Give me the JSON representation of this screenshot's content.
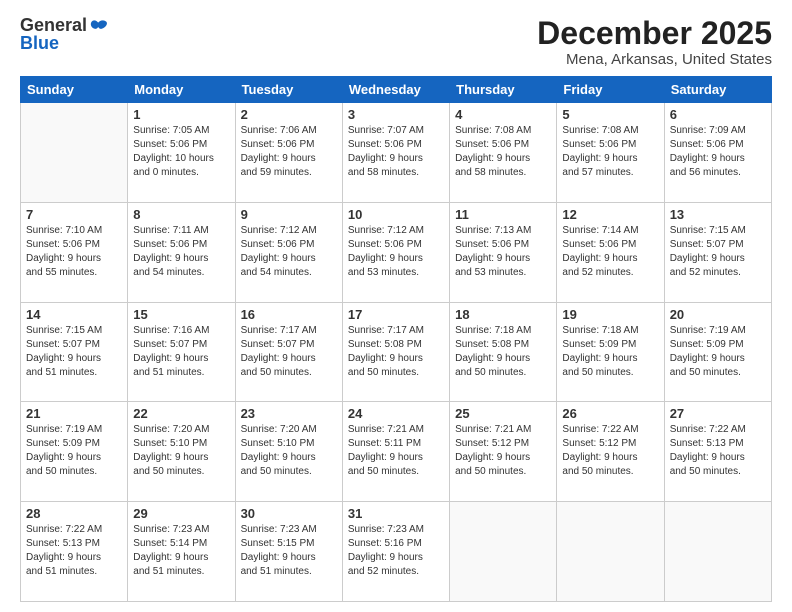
{
  "logo": {
    "general": "General",
    "blue": "Blue"
  },
  "header": {
    "title": "December 2025",
    "subtitle": "Mena, Arkansas, United States"
  },
  "weekdays": [
    "Sunday",
    "Monday",
    "Tuesday",
    "Wednesday",
    "Thursday",
    "Friday",
    "Saturday"
  ],
  "weeks": [
    [
      {
        "day": "",
        "info": ""
      },
      {
        "day": "1",
        "info": "Sunrise: 7:05 AM\nSunset: 5:06 PM\nDaylight: 10 hours\nand 0 minutes."
      },
      {
        "day": "2",
        "info": "Sunrise: 7:06 AM\nSunset: 5:06 PM\nDaylight: 9 hours\nand 59 minutes."
      },
      {
        "day": "3",
        "info": "Sunrise: 7:07 AM\nSunset: 5:06 PM\nDaylight: 9 hours\nand 58 minutes."
      },
      {
        "day": "4",
        "info": "Sunrise: 7:08 AM\nSunset: 5:06 PM\nDaylight: 9 hours\nand 58 minutes."
      },
      {
        "day": "5",
        "info": "Sunrise: 7:08 AM\nSunset: 5:06 PM\nDaylight: 9 hours\nand 57 minutes."
      },
      {
        "day": "6",
        "info": "Sunrise: 7:09 AM\nSunset: 5:06 PM\nDaylight: 9 hours\nand 56 minutes."
      }
    ],
    [
      {
        "day": "7",
        "info": "Sunrise: 7:10 AM\nSunset: 5:06 PM\nDaylight: 9 hours\nand 55 minutes."
      },
      {
        "day": "8",
        "info": "Sunrise: 7:11 AM\nSunset: 5:06 PM\nDaylight: 9 hours\nand 54 minutes."
      },
      {
        "day": "9",
        "info": "Sunrise: 7:12 AM\nSunset: 5:06 PM\nDaylight: 9 hours\nand 54 minutes."
      },
      {
        "day": "10",
        "info": "Sunrise: 7:12 AM\nSunset: 5:06 PM\nDaylight: 9 hours\nand 53 minutes."
      },
      {
        "day": "11",
        "info": "Sunrise: 7:13 AM\nSunset: 5:06 PM\nDaylight: 9 hours\nand 53 minutes."
      },
      {
        "day": "12",
        "info": "Sunrise: 7:14 AM\nSunset: 5:06 PM\nDaylight: 9 hours\nand 52 minutes."
      },
      {
        "day": "13",
        "info": "Sunrise: 7:15 AM\nSunset: 5:07 PM\nDaylight: 9 hours\nand 52 minutes."
      }
    ],
    [
      {
        "day": "14",
        "info": "Sunrise: 7:15 AM\nSunset: 5:07 PM\nDaylight: 9 hours\nand 51 minutes."
      },
      {
        "day": "15",
        "info": "Sunrise: 7:16 AM\nSunset: 5:07 PM\nDaylight: 9 hours\nand 51 minutes."
      },
      {
        "day": "16",
        "info": "Sunrise: 7:17 AM\nSunset: 5:07 PM\nDaylight: 9 hours\nand 50 minutes."
      },
      {
        "day": "17",
        "info": "Sunrise: 7:17 AM\nSunset: 5:08 PM\nDaylight: 9 hours\nand 50 minutes."
      },
      {
        "day": "18",
        "info": "Sunrise: 7:18 AM\nSunset: 5:08 PM\nDaylight: 9 hours\nand 50 minutes."
      },
      {
        "day": "19",
        "info": "Sunrise: 7:18 AM\nSunset: 5:09 PM\nDaylight: 9 hours\nand 50 minutes."
      },
      {
        "day": "20",
        "info": "Sunrise: 7:19 AM\nSunset: 5:09 PM\nDaylight: 9 hours\nand 50 minutes."
      }
    ],
    [
      {
        "day": "21",
        "info": "Sunrise: 7:19 AM\nSunset: 5:09 PM\nDaylight: 9 hours\nand 50 minutes."
      },
      {
        "day": "22",
        "info": "Sunrise: 7:20 AM\nSunset: 5:10 PM\nDaylight: 9 hours\nand 50 minutes."
      },
      {
        "day": "23",
        "info": "Sunrise: 7:20 AM\nSunset: 5:10 PM\nDaylight: 9 hours\nand 50 minutes."
      },
      {
        "day": "24",
        "info": "Sunrise: 7:21 AM\nSunset: 5:11 PM\nDaylight: 9 hours\nand 50 minutes."
      },
      {
        "day": "25",
        "info": "Sunrise: 7:21 AM\nSunset: 5:12 PM\nDaylight: 9 hours\nand 50 minutes."
      },
      {
        "day": "26",
        "info": "Sunrise: 7:22 AM\nSunset: 5:12 PM\nDaylight: 9 hours\nand 50 minutes."
      },
      {
        "day": "27",
        "info": "Sunrise: 7:22 AM\nSunset: 5:13 PM\nDaylight: 9 hours\nand 50 minutes."
      }
    ],
    [
      {
        "day": "28",
        "info": "Sunrise: 7:22 AM\nSunset: 5:13 PM\nDaylight: 9 hours\nand 51 minutes."
      },
      {
        "day": "29",
        "info": "Sunrise: 7:23 AM\nSunset: 5:14 PM\nDaylight: 9 hours\nand 51 minutes."
      },
      {
        "day": "30",
        "info": "Sunrise: 7:23 AM\nSunset: 5:15 PM\nDaylight: 9 hours\nand 51 minutes."
      },
      {
        "day": "31",
        "info": "Sunrise: 7:23 AM\nSunset: 5:16 PM\nDaylight: 9 hours\nand 52 minutes."
      },
      {
        "day": "",
        "info": ""
      },
      {
        "day": "",
        "info": ""
      },
      {
        "day": "",
        "info": ""
      }
    ]
  ]
}
